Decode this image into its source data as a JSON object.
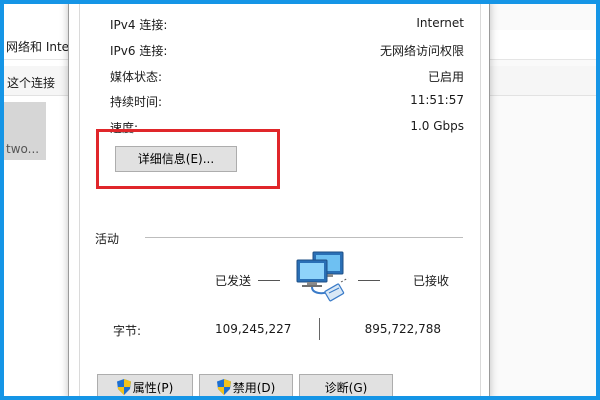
{
  "background_window": {
    "row1_text": "网络和 Inte",
    "row2_text": "这个连接",
    "tile_text": "two..."
  },
  "dialog": {
    "info_rows": [
      {
        "label": "IPv4 连接:",
        "value": "Internet"
      },
      {
        "label": "IPv6 连接:",
        "value": "无网络访问权限"
      },
      {
        "label": "媒体状态:",
        "value": "已启用"
      },
      {
        "label": "持续时间:",
        "value": "11:51:57"
      },
      {
        "label": "速度:",
        "value": "1.0 Gbps"
      }
    ],
    "details_button": "详细信息(E)...",
    "activity": {
      "title": "活动",
      "sent_label": "已发送",
      "received_label": "已接收",
      "bytes_label": "字节:",
      "bytes_sent": "109,245,227",
      "bytes_received": "895,722,788"
    },
    "buttons": {
      "properties": "属性(P)",
      "disable": "禁用(D)",
      "diagnose": "诊断(G)"
    }
  },
  "colors": {
    "frame": "#1595e6",
    "highlight": "#e0262a",
    "button_face": "#e1e1e1"
  },
  "icons": {
    "network": "network-computers-icon",
    "shield": "uac-shield-icon"
  }
}
